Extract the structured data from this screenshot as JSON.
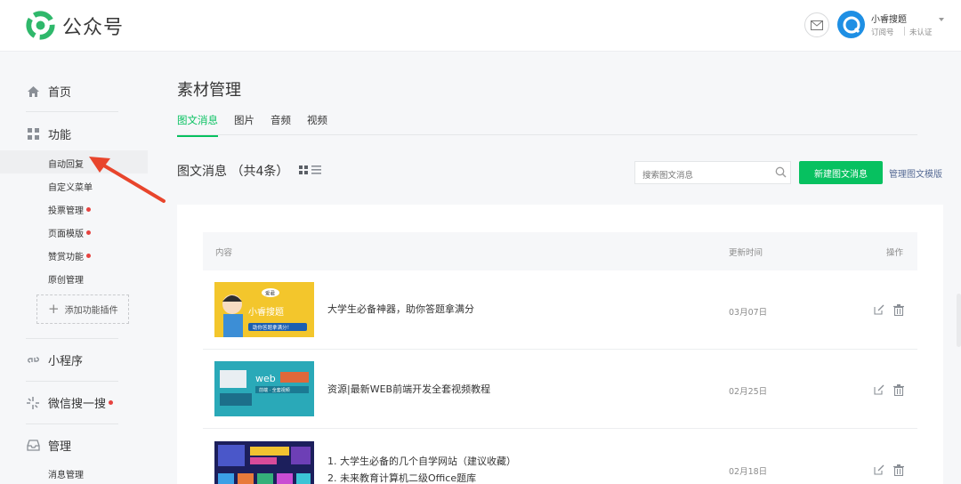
{
  "brand": {
    "name": "公众号"
  },
  "account": {
    "name": "小睿搜题",
    "type": "订阅号",
    "verify": "未认证"
  },
  "sidebar": {
    "home": "首页",
    "function": "功能",
    "function_items": [
      "自动回复",
      "自定义菜单",
      "投票管理",
      "页面模版",
      "赞赏功能",
      "原创管理"
    ],
    "add_plugin": "添加功能插件",
    "miniprogram": "小程序",
    "wechat_search": "微信搜一搜",
    "manage": "管理",
    "manage_items": [
      "消息管理"
    ]
  },
  "main": {
    "title": "素材管理",
    "tabs": [
      "图文消息",
      "图片",
      "音频",
      "视频"
    ],
    "section_title": "图文消息 （共4条）",
    "search_placeholder": "搜索图文消息",
    "new_button": "新建图文消息",
    "manage_link": "管理图文模版",
    "columns": [
      "内容",
      "更新时间",
      "操作"
    ],
    "rows": [
      {
        "title_lines": [
          "大学生必备神器，助你答题拿满分"
        ],
        "date": "03月07日",
        "thumb_text": "小睿搜题",
        "thumb_sub": "助你答题拿满分！",
        "thumb_badge": "爱君"
      },
      {
        "title_lines": [
          "资源|最新WEB前端开发全套视频教程"
        ],
        "date": "02月25日",
        "thumb_text": "web",
        "thumb_sub": "前端 · 全套视频"
      },
      {
        "title_lines": [
          "1. 大学生必备的几个自学网站（建议收藏）",
          "2. 未来教育计算机二级Office题库"
        ],
        "date": "02月18日"
      }
    ]
  },
  "colors": {
    "accent": "#07c160",
    "link": "#576b95",
    "badge": "#e64340",
    "arrow": "#e8452c"
  }
}
